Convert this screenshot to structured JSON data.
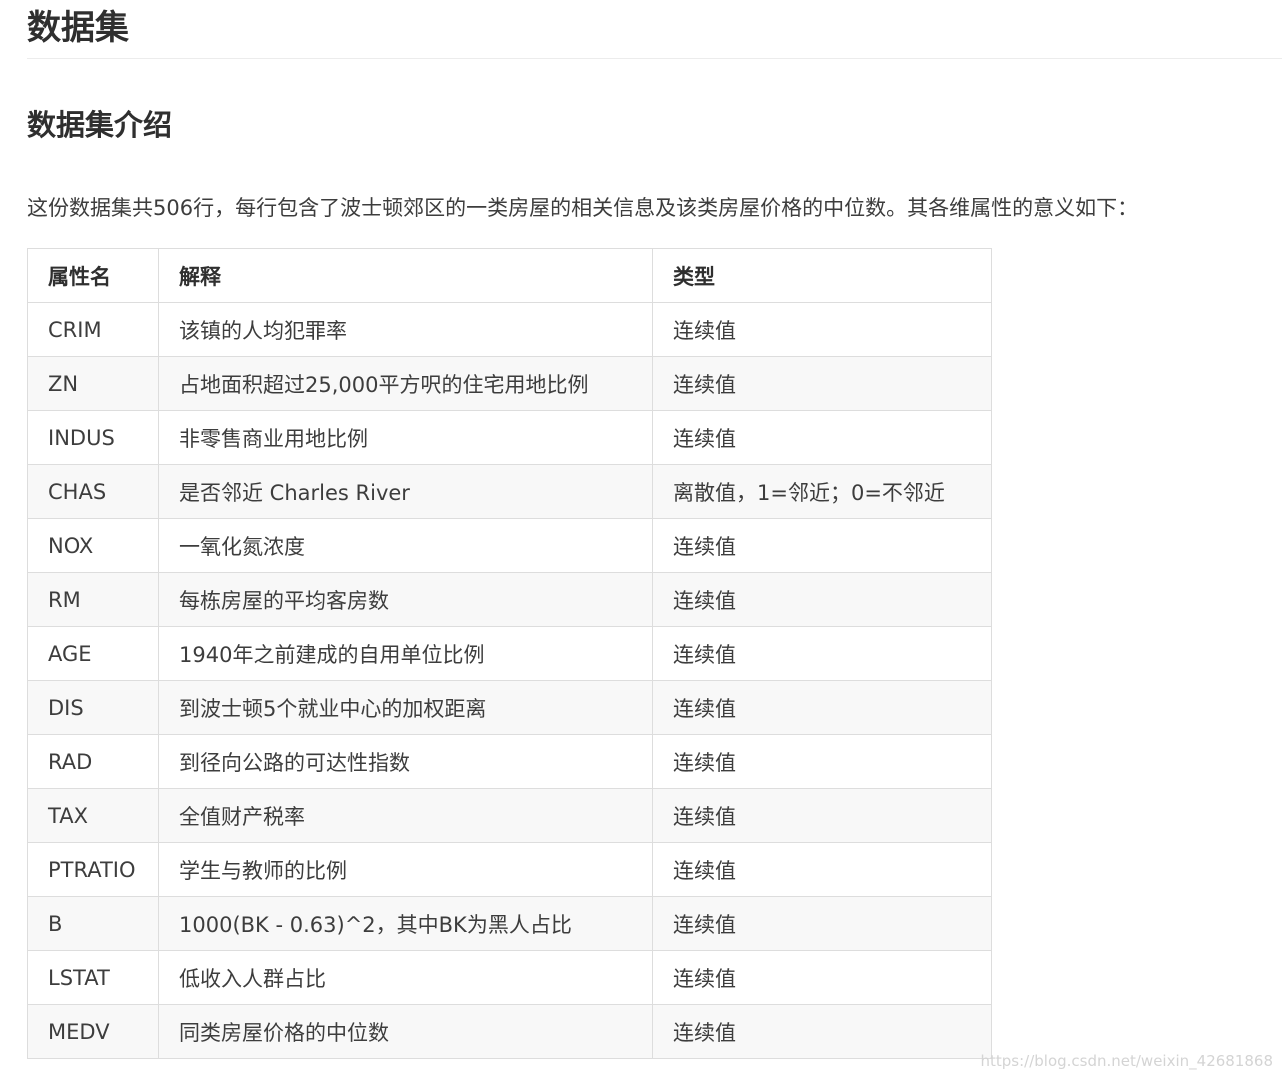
{
  "heading1": "数据集",
  "heading2": "数据集介绍",
  "intro": "这份数据集共506行，每行包含了波士顿郊区的一类房屋的相关信息及该类房屋价格的中位数。其各维属性的意义如下：",
  "table": {
    "headers": [
      "属性名",
      "解释",
      "类型"
    ],
    "rows": [
      [
        "CRIM",
        "该镇的人均犯罪率",
        "连续值"
      ],
      [
        "ZN",
        "占地面积超过25,000平方呎的住宅用地比例",
        "连续值"
      ],
      [
        "INDUS",
        "非零售商业用地比例",
        "连续值"
      ],
      [
        "CHAS",
        "是否邻近 Charles River",
        "离散值，1=邻近；0=不邻近"
      ],
      [
        "NOX",
        "一氧化氮浓度",
        "连续值"
      ],
      [
        "RM",
        "每栋房屋的平均客房数",
        "连续值"
      ],
      [
        "AGE",
        "1940年之前建成的自用单位比例",
        "连续值"
      ],
      [
        "DIS",
        "到波士顿5个就业中心的加权距离",
        "连续值"
      ],
      [
        "RAD",
        "到径向公路的可达性指数",
        "连续值"
      ],
      [
        "TAX",
        "全值财产税率",
        "连续值"
      ],
      [
        "PTRATIO",
        "学生与教师的比例",
        "连续值"
      ],
      [
        "B",
        "1000(BK - 0.63)^2，其中BK为黑人占比",
        "连续值"
      ],
      [
        "LSTAT",
        "低收入人群占比",
        "连续值"
      ],
      [
        "MEDV",
        "同类房屋价格的中位数",
        "连续值"
      ]
    ]
  },
  "watermark": "https://blog.csdn.net/weixin_42681868"
}
